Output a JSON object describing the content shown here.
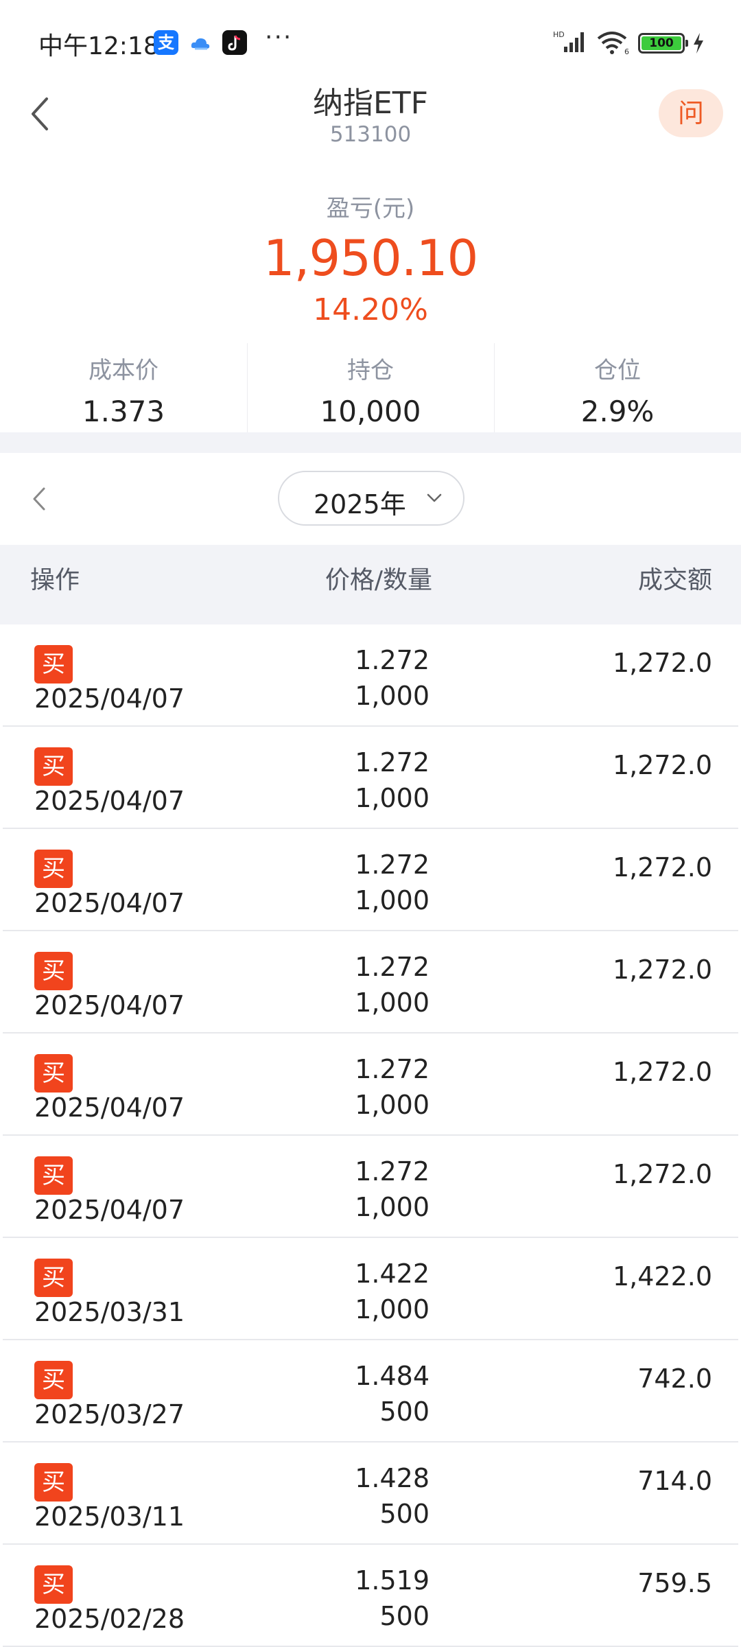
{
  "status_bar": {
    "time": "中午12:18",
    "alipay_icon_label": "支",
    "more": "···",
    "battery": "100"
  },
  "header": {
    "title": "纳指ETF",
    "code": "513100",
    "ask_label": "问"
  },
  "summary": {
    "pnl_label": "盈亏(元)",
    "pnl_value": "1,950.10",
    "pnl_pct": "14.20%",
    "accent_color": "#ee4d1e",
    "stats": [
      {
        "label": "成本价",
        "value": "1.373"
      },
      {
        "label": "持仓",
        "value": "10,000"
      },
      {
        "label": "仓位",
        "value": "2.9%"
      }
    ]
  },
  "year_selector": {
    "value": "2025年"
  },
  "table": {
    "headers": {
      "op": "操作",
      "price_qty": "价格/数量",
      "amount": "成交额"
    },
    "rows": [
      {
        "type": "买",
        "date": "2025/04/07",
        "price": "1.272",
        "qty": "1,000",
        "amount": "1,272.0"
      },
      {
        "type": "买",
        "date": "2025/04/07",
        "price": "1.272",
        "qty": "1,000",
        "amount": "1,272.0"
      },
      {
        "type": "买",
        "date": "2025/04/07",
        "price": "1.272",
        "qty": "1,000",
        "amount": "1,272.0"
      },
      {
        "type": "买",
        "date": "2025/04/07",
        "price": "1.272",
        "qty": "1,000",
        "amount": "1,272.0"
      },
      {
        "type": "买",
        "date": "2025/04/07",
        "price": "1.272",
        "qty": "1,000",
        "amount": "1,272.0"
      },
      {
        "type": "买",
        "date": "2025/04/07",
        "price": "1.272",
        "qty": "1,000",
        "amount": "1,272.0"
      },
      {
        "type": "买",
        "date": "2025/03/31",
        "price": "1.422",
        "qty": "1,000",
        "amount": "1,422.0"
      },
      {
        "type": "买",
        "date": "2025/03/27",
        "price": "1.484",
        "qty": "500",
        "amount": "742.0"
      },
      {
        "type": "买",
        "date": "2025/03/11",
        "price": "1.428",
        "qty": "500",
        "amount": "714.0"
      },
      {
        "type": "买",
        "date": "2025/02/28",
        "price": "1.519",
        "qty": "500",
        "amount": "759.5"
      }
    ]
  }
}
